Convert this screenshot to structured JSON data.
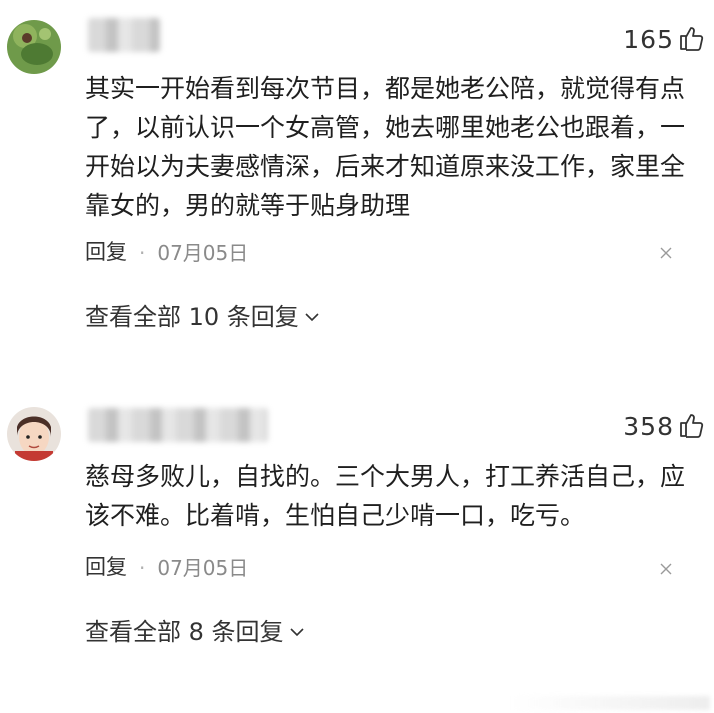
{
  "comments": [
    {
      "likes": "165",
      "text": "其实一开始看到每次节目，都是她老公陪，就觉得有点了，以前认识一个女高管，她去哪里她老公也跟着，一开始以为夫妻感情深，后来才知道原来没工作，家里全靠女的，男的就等于贴身助理",
      "reply_label": "回复",
      "date": "07月05日",
      "view_replies": "查看全部 10 条回复"
    },
    {
      "likes": "358",
      "text": "慈母多败儿，自找的。三个大男人，打工养活自己，应该不难。比着啃，生怕自己少啃一口，吃亏。",
      "reply_label": "回复",
      "date": "07月05日",
      "view_replies": "查看全部 8 条回复"
    }
  ],
  "icons": {
    "like": "thumbs-up-icon",
    "close": "close-icon",
    "expand": "chevron-down-icon"
  }
}
